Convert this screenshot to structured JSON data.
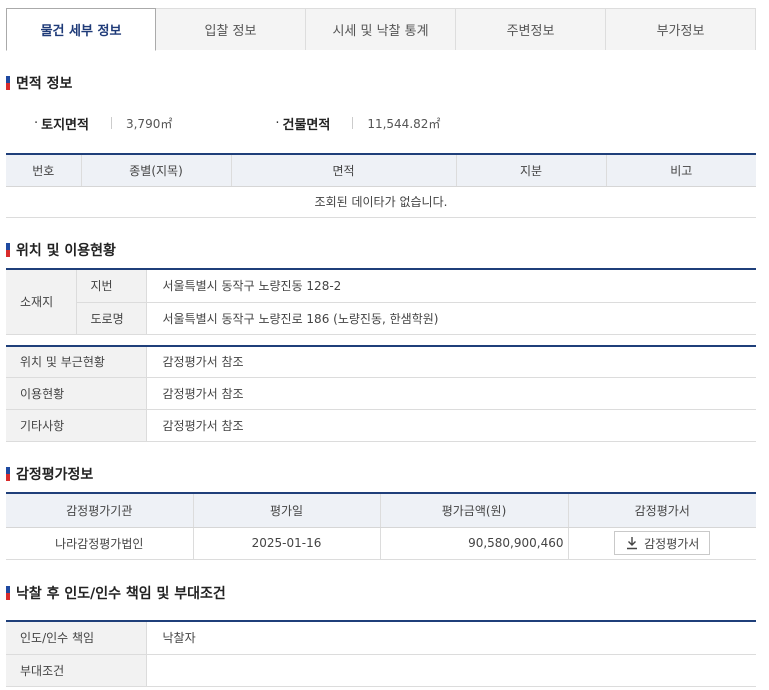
{
  "tabs": [
    {
      "label": "물건 세부 정보"
    },
    {
      "label": "입찰 정보"
    },
    {
      "label": "시세 및 낙찰 통계"
    },
    {
      "label": "주변정보"
    },
    {
      "label": "부가정보"
    }
  ],
  "area": {
    "title": "면적 정보",
    "land_label": "토지면적",
    "land_value": "3,790㎡",
    "building_label": "건물면적",
    "building_value": "11,544.82㎡",
    "headers": [
      "번호",
      "종별(지목)",
      "면적",
      "지분",
      "비고"
    ],
    "empty_message": "조회된 데이타가 없습니다."
  },
  "location": {
    "title": "위치 및 이용현황",
    "address_label": "소재지",
    "lot_label": "지번",
    "lot_value": "서울특별시 동작구 노량진동 128-2",
    "road_label": "도로명",
    "road_value": "서울특별시 동작구 노량진로 186 (노량진동, 한샘학원)",
    "rows": [
      {
        "label": "위치 및 부근현황",
        "value": "감정평가서 참조"
      },
      {
        "label": "이용현황",
        "value": "감정평가서 참조"
      },
      {
        "label": "기타사항",
        "value": "감정평가서 참조"
      }
    ]
  },
  "appraisal": {
    "title": "감정평가정보",
    "headers": [
      "감정평가기관",
      "평가일",
      "평가금액(원)",
      "감정평가서"
    ],
    "agency": "나라감정평가법인",
    "date": "2025-01-16",
    "amount": "90,580,900,460",
    "button_label": "감정평가서"
  },
  "conditions": {
    "title": "낙찰 후 인도/인수 책임 및 부대조건",
    "rows": [
      {
        "label": "인도/인수 책임",
        "value": "낙찰자"
      },
      {
        "label": "부대조건",
        "value": ""
      }
    ]
  }
}
